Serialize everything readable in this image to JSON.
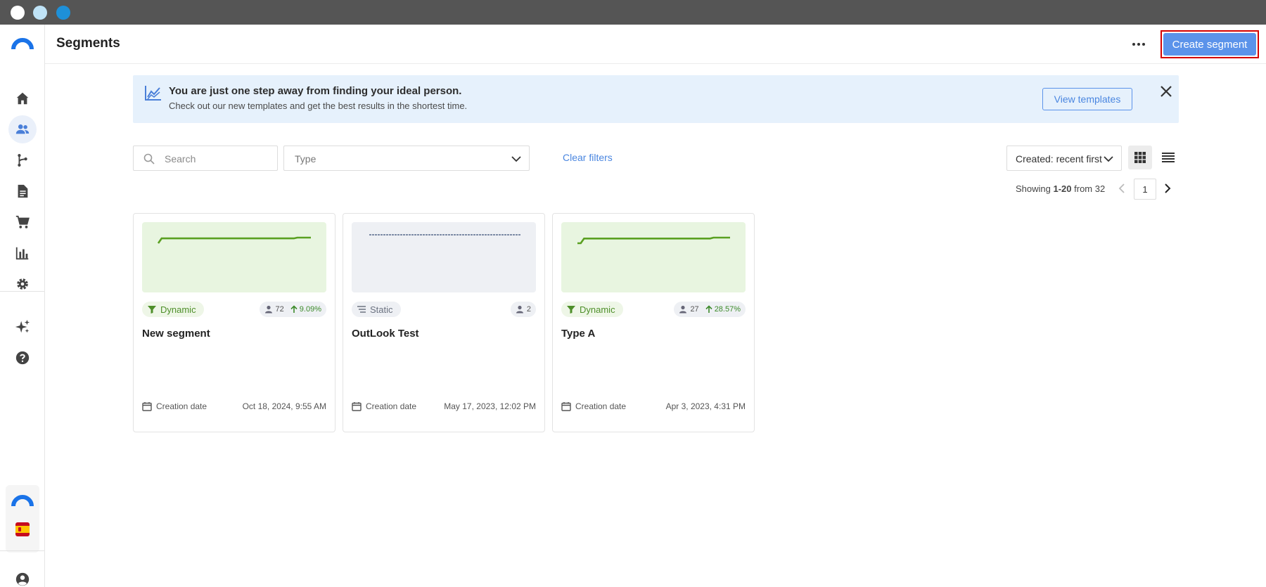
{
  "window": {
    "buttons": [
      "close",
      "minimize",
      "maximize"
    ]
  },
  "sidebar": {
    "items": [
      {
        "id": "home",
        "icon": "home-icon"
      },
      {
        "id": "segments",
        "icon": "users-icon",
        "active": true
      },
      {
        "id": "flows",
        "icon": "branch-icon"
      },
      {
        "id": "content",
        "icon": "document-icon"
      },
      {
        "id": "ecommerce",
        "icon": "cart-icon"
      },
      {
        "id": "analytics",
        "icon": "bar-chart-icon"
      },
      {
        "id": "settings",
        "icon": "gear-icon"
      },
      {
        "id": "ai",
        "icon": "sparkles-icon"
      },
      {
        "id": "help",
        "icon": "help-icon"
      }
    ],
    "language_flag": "spain-flag-icon",
    "profile_icon": "account-icon"
  },
  "header": {
    "title": "Segments",
    "more_icon": "more-horizontal-icon",
    "create_label": "Create segment"
  },
  "banner": {
    "title": "You are just one step away from finding your ideal person.",
    "subtitle": "Check out our new templates and get the best results in the shortest time.",
    "button_label": "View templates"
  },
  "filters": {
    "search_placeholder": "Search",
    "type_label": "Type",
    "clear_label": "Clear filters",
    "sort_label": "Created: recent first"
  },
  "pagination": {
    "showing_prefix": "Showing ",
    "range": "1-20",
    "from_text": " from 32",
    "current_page": "1"
  },
  "colors": {
    "accent": "#5b93ea",
    "dynamic_green": "#4e8f2a",
    "dynamic_bg": "#e8f5e0",
    "static_bg": "#eef0f4",
    "highlight_border": "#d40000"
  },
  "cards": [
    {
      "name": "New segment",
      "type": "Dynamic",
      "kind": "dyn",
      "count": "72",
      "growth": "9.09%",
      "creation_label": "Creation date",
      "date": "Oct 18, 2024, 9:55 AM",
      "sparkline": [
        66,
        72,
        72,
        72,
        72,
        72,
        72,
        72,
        72,
        72,
        72,
        72,
        72,
        72,
        72,
        72,
        72,
        72,
        72,
        72,
        72,
        72,
        72,
        72,
        72,
        72,
        72,
        72,
        72,
        72,
        72,
        72,
        72,
        72,
        72,
        72,
        72,
        72,
        72,
        72,
        72,
        73,
        73,
        73,
        73,
        73
      ]
    },
    {
      "name": "OutLook Test",
      "type": "Static",
      "kind": "sta",
      "count": "2",
      "growth": "",
      "creation_label": "Creation date",
      "date": "May 17, 2023, 12:02 PM",
      "sparkline": [
        2,
        2,
        2,
        2,
        2,
        2,
        2,
        2,
        2,
        2,
        2,
        2,
        2,
        2,
        2,
        2,
        2,
        2,
        2,
        2,
        2,
        2,
        2,
        2,
        2,
        2,
        2,
        2,
        2,
        2
      ]
    },
    {
      "name": "Type A",
      "type": "Dynamic",
      "kind": "dyn",
      "count": "27",
      "growth": "28.57%",
      "creation_label": "Creation date",
      "date": "Apr 3, 2023, 4:31 PM",
      "sparkline": [
        21,
        21,
        26,
        26,
        26,
        26,
        26,
        26,
        26,
        26,
        26,
        26,
        26,
        26,
        26,
        26,
        26,
        26,
        26,
        26,
        26,
        26,
        26,
        26,
        26,
        26,
        26,
        26,
        26,
        26,
        26,
        26,
        26,
        26,
        26,
        26,
        26,
        26,
        26,
        26,
        26,
        27,
        27,
        27,
        27,
        27,
        27
      ]
    }
  ]
}
